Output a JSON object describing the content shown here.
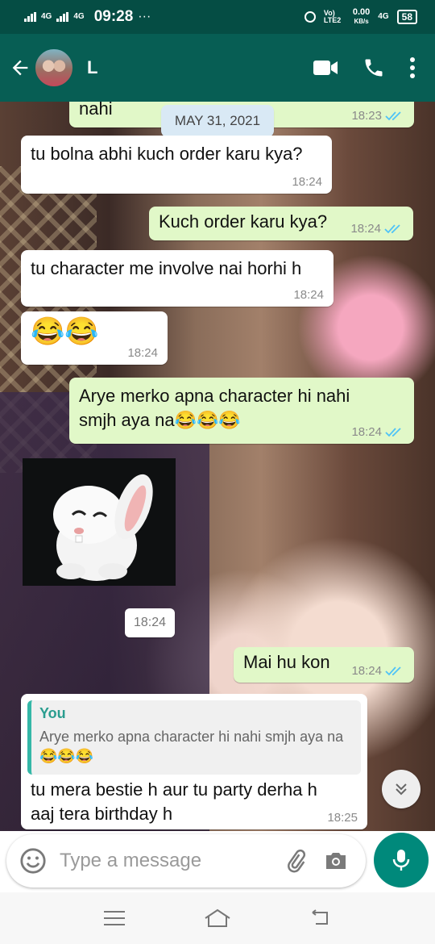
{
  "status_bar": {
    "net1": "4G",
    "net2": "4G",
    "time": "09:28",
    "dots": "···",
    "volte": "Vo) LTE2",
    "speed_value": "0.00",
    "speed_unit": "KB/s",
    "net3": "4G",
    "battery": "58"
  },
  "header": {
    "contact_name": "L"
  },
  "chat": {
    "date_chip": "MAY 31, 2021",
    "messages": [
      {
        "text": "nahi",
        "time": "18:23"
      },
      {
        "text": "tu bolna abhi kuch order karu kya?",
        "time": "18:24"
      },
      {
        "text": "Kuch order karu kya?",
        "time": "18:24"
      },
      {
        "text": "tu character me involve nai horhi h",
        "time": "18:24"
      },
      {
        "text": "😂😂",
        "time": "18:24"
      },
      {
        "text": "Arye merko apna character hi nahi smjh aya na😂😂😂",
        "time": "18:24"
      },
      {
        "text": "",
        "time": "18:24"
      },
      {
        "text": "Mai hu kon",
        "time": "18:24"
      },
      {
        "reply_author": "You",
        "reply_text": "Arye merko apna character hi nahi smjh aya na😂😂😂",
        "text": "tu mera bestie h aur tu party derha h aaj tera birthday h",
        "time": "18:25"
      }
    ]
  },
  "input": {
    "placeholder": "Type a message"
  },
  "colors": {
    "header": "#075e54",
    "statusbar": "#054d44",
    "outgoing_bubble": "#e1f8c8",
    "incoming_bubble": "#ffffff",
    "read_ticks": "#4fc3f7",
    "mic_button": "#00897b"
  }
}
